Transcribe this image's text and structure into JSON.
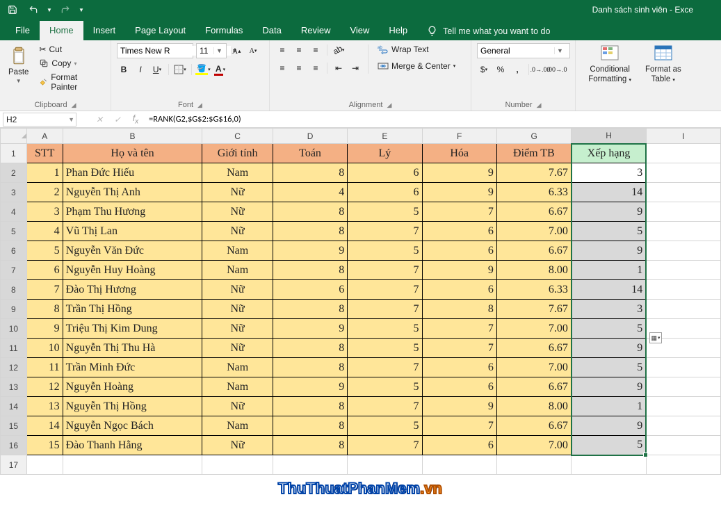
{
  "window_title": "Danh sách sinh viên  -  Exce",
  "tabs": {
    "file": "File",
    "home": "Home",
    "insert": "Insert",
    "pagelayout": "Page Layout",
    "formulas": "Formulas",
    "data": "Data",
    "review": "Review",
    "view": "View",
    "help": "Help"
  },
  "tellme": "Tell me what you want to do",
  "clipboard": {
    "paste": "Paste",
    "cut": "Cut",
    "copy": "Copy",
    "painter": "Format Painter",
    "label": "Clipboard"
  },
  "font": {
    "name": "Times New R",
    "size": "11",
    "label": "Font"
  },
  "alignment": {
    "wrap": "Wrap Text",
    "merge": "Merge & Center",
    "label": "Alignment"
  },
  "number": {
    "format": "General",
    "label": "Number"
  },
  "styles": {
    "cond": "Conditional",
    "cond2": "Formatting",
    "fat": "Format as",
    "fat2": "Table"
  },
  "namebox": "H2",
  "formula": "=RANK(G2,$G$2:$G$16,0)",
  "columns": [
    "",
    "A",
    "B",
    "C",
    "D",
    "E",
    "F",
    "G",
    "H",
    "I"
  ],
  "headers": {
    "A": "STT",
    "B": "Họ và tên",
    "C": "Giới tính",
    "D": "Toán",
    "E": "Lý",
    "F": "Hóa",
    "G": "Điểm TB",
    "H": "Xếp hạng"
  },
  "rows": [
    {
      "r": 1
    },
    {
      "r": 2,
      "A": "1",
      "B": "Phan Đức Hiếu",
      "C": "Nam",
      "D": "8",
      "E": "6",
      "F": "9",
      "G": "7.67",
      "H": "3"
    },
    {
      "r": 3,
      "A": "2",
      "B": "Nguyễn Thị Anh",
      "C": "Nữ",
      "D": "4",
      "E": "6",
      "F": "9",
      "G": "6.33",
      "H": "14"
    },
    {
      "r": 4,
      "A": "3",
      "B": "Phạm Thu Hương",
      "C": "Nữ",
      "D": "8",
      "E": "5",
      "F": "7",
      "G": "6.67",
      "H": "9"
    },
    {
      "r": 5,
      "A": "4",
      "B": "Vũ Thị Lan",
      "C": "Nữ",
      "D": "8",
      "E": "7",
      "F": "6",
      "G": "7.00",
      "H": "5"
    },
    {
      "r": 6,
      "A": "5",
      "B": "Nguyễn Văn Đức",
      "C": "Nam",
      "D": "9",
      "E": "5",
      "F": "6",
      "G": "6.67",
      "H": "9"
    },
    {
      "r": 7,
      "A": "6",
      "B": "Nguyễn Huy Hoàng",
      "C": "Nam",
      "D": "8",
      "E": "7",
      "F": "9",
      "G": "8.00",
      "H": "1"
    },
    {
      "r": 8,
      "A": "7",
      "B": "Đào Thị Hương",
      "C": "Nữ",
      "D": "6",
      "E": "7",
      "F": "6",
      "G": "6.33",
      "H": "14"
    },
    {
      "r": 9,
      "A": "8",
      "B": "Trần Thị Hồng",
      "C": "Nữ",
      "D": "8",
      "E": "7",
      "F": "8",
      "G": "7.67",
      "H": "3"
    },
    {
      "r": 10,
      "A": "9",
      "B": "Triệu Thị Kim Dung",
      "C": "Nữ",
      "D": "9",
      "E": "5",
      "F": "7",
      "G": "7.00",
      "H": "5"
    },
    {
      "r": 11,
      "A": "10",
      "B": "Nguyễn Thị Thu Hà",
      "C": "Nữ",
      "D": "8",
      "E": "5",
      "F": "7",
      "G": "6.67",
      "H": "9"
    },
    {
      "r": 12,
      "A": "11",
      "B": "Trần Minh Đức",
      "C": "Nam",
      "D": "8",
      "E": "7",
      "F": "6",
      "G": "7.00",
      "H": "5"
    },
    {
      "r": 13,
      "A": "12",
      "B": "Nguyễn Hoàng",
      "C": "Nam",
      "D": "9",
      "E": "5",
      "F": "6",
      "G": "6.67",
      "H": "9"
    },
    {
      "r": 14,
      "A": "13",
      "B": "Nguyễn Thị Hồng",
      "C": "Nữ",
      "D": "8",
      "E": "7",
      "F": "9",
      "G": "8.00",
      "H": "1"
    },
    {
      "r": 15,
      "A": "14",
      "B": "Nguyễn Ngọc Bách",
      "C": "Nam",
      "D": "8",
      "E": "5",
      "F": "7",
      "G": "6.67",
      "H": "9"
    },
    {
      "r": 16,
      "A": "15",
      "B": "Đào Thanh Hằng",
      "C": "Nữ",
      "D": "8",
      "E": "7",
      "F": "6",
      "G": "7.00",
      "H": "5"
    },
    {
      "r": 17
    }
  ],
  "watermark1": "ThuThuatPhanMem",
  "watermark2": ".vn"
}
